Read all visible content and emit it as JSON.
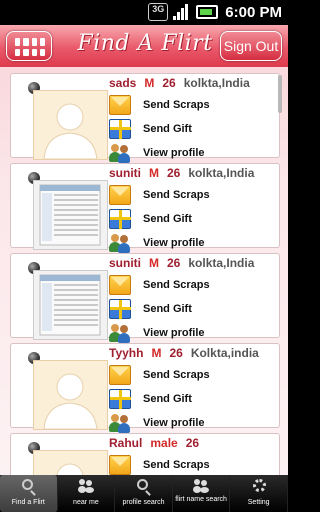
{
  "status_bar": {
    "network": "3G",
    "time": "6:00 PM"
  },
  "header": {
    "title": "Find A Flirt",
    "sign_out_label": "Sign Out"
  },
  "actions": {
    "send_scraps": "Send Scraps",
    "send_gift": "Send Gift",
    "view_profile": "View profile"
  },
  "profiles": [
    {
      "name": "sads",
      "gender": "M",
      "age": "26",
      "location": "kolkta,India",
      "photo": "silhouette"
    },
    {
      "name": "suniti",
      "gender": "M",
      "age": "26",
      "location": "kolkta,India",
      "photo": "screenshot"
    },
    {
      "name": "suniti",
      "gender": "M",
      "age": "26",
      "location": "kolkta,India",
      "photo": "screenshot"
    },
    {
      "name": "Tyyhh",
      "gender": "M",
      "age": "26",
      "location": "Kolkta,india",
      "photo": "silhouette"
    },
    {
      "name": "Rahul",
      "gender": "male",
      "age": "26",
      "location": "",
      "photo": "silhouette"
    }
  ],
  "tabs": [
    {
      "label": "Find a Flirt",
      "icon": "search-icon"
    },
    {
      "label": "near me",
      "icon": "people-icon"
    },
    {
      "label": "profile search",
      "icon": "search-icon"
    },
    {
      "label": "flirt name search",
      "icon": "people-icon"
    },
    {
      "label": "Setting",
      "icon": "gear-icon"
    }
  ],
  "colors": {
    "header": "#e9596a",
    "name": "#a02030",
    "gender": "#d42a2a",
    "location": "#555555"
  }
}
